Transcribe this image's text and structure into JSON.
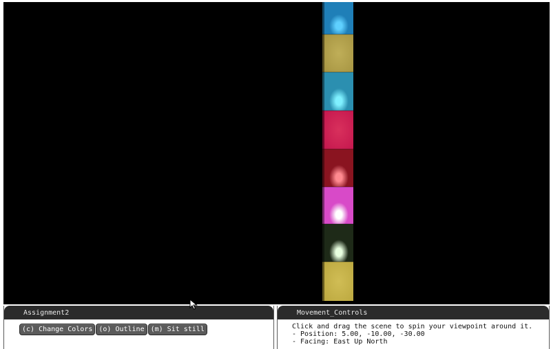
{
  "scene": {
    "background": "#000000",
    "cubes": [
      {
        "color": "#1f7fb8",
        "highlight": "#5fd0ff",
        "lit": true
      },
      {
        "color": "#a08e3c",
        "highlight": "#bfae58",
        "lit": false
      },
      {
        "color": "#2b8fb0",
        "highlight": "#7ff0ff",
        "lit": true
      },
      {
        "color": "#c0104a",
        "highlight": "#d8305c",
        "lit": false
      },
      {
        "color": "#8a1420",
        "highlight": "#ff8a90",
        "lit": true
      },
      {
        "color": "#d84ac8",
        "highlight": "#ffffff",
        "lit": true
      },
      {
        "color": "#1e2a18",
        "highlight": "#e8ffe0",
        "lit": true
      },
      {
        "color": "#b7a33a",
        "highlight": "#d0bd55",
        "lit": false
      }
    ]
  },
  "assignment_panel": {
    "title": "Assignment2",
    "buttons": [
      {
        "label": "(c) Change Colors"
      },
      {
        "label": "(o) Outline"
      },
      {
        "label": "(m) Sit still"
      }
    ]
  },
  "movement_panel": {
    "title": "Movement_Controls",
    "lines": [
      "Click and drag the scene to spin your viewpoint around it.",
      "- Position: 5.00, -10.00, -30.00",
      "- Facing: East Up North"
    ]
  },
  "cursor": {
    "icon": "arrow-pointer-icon"
  }
}
